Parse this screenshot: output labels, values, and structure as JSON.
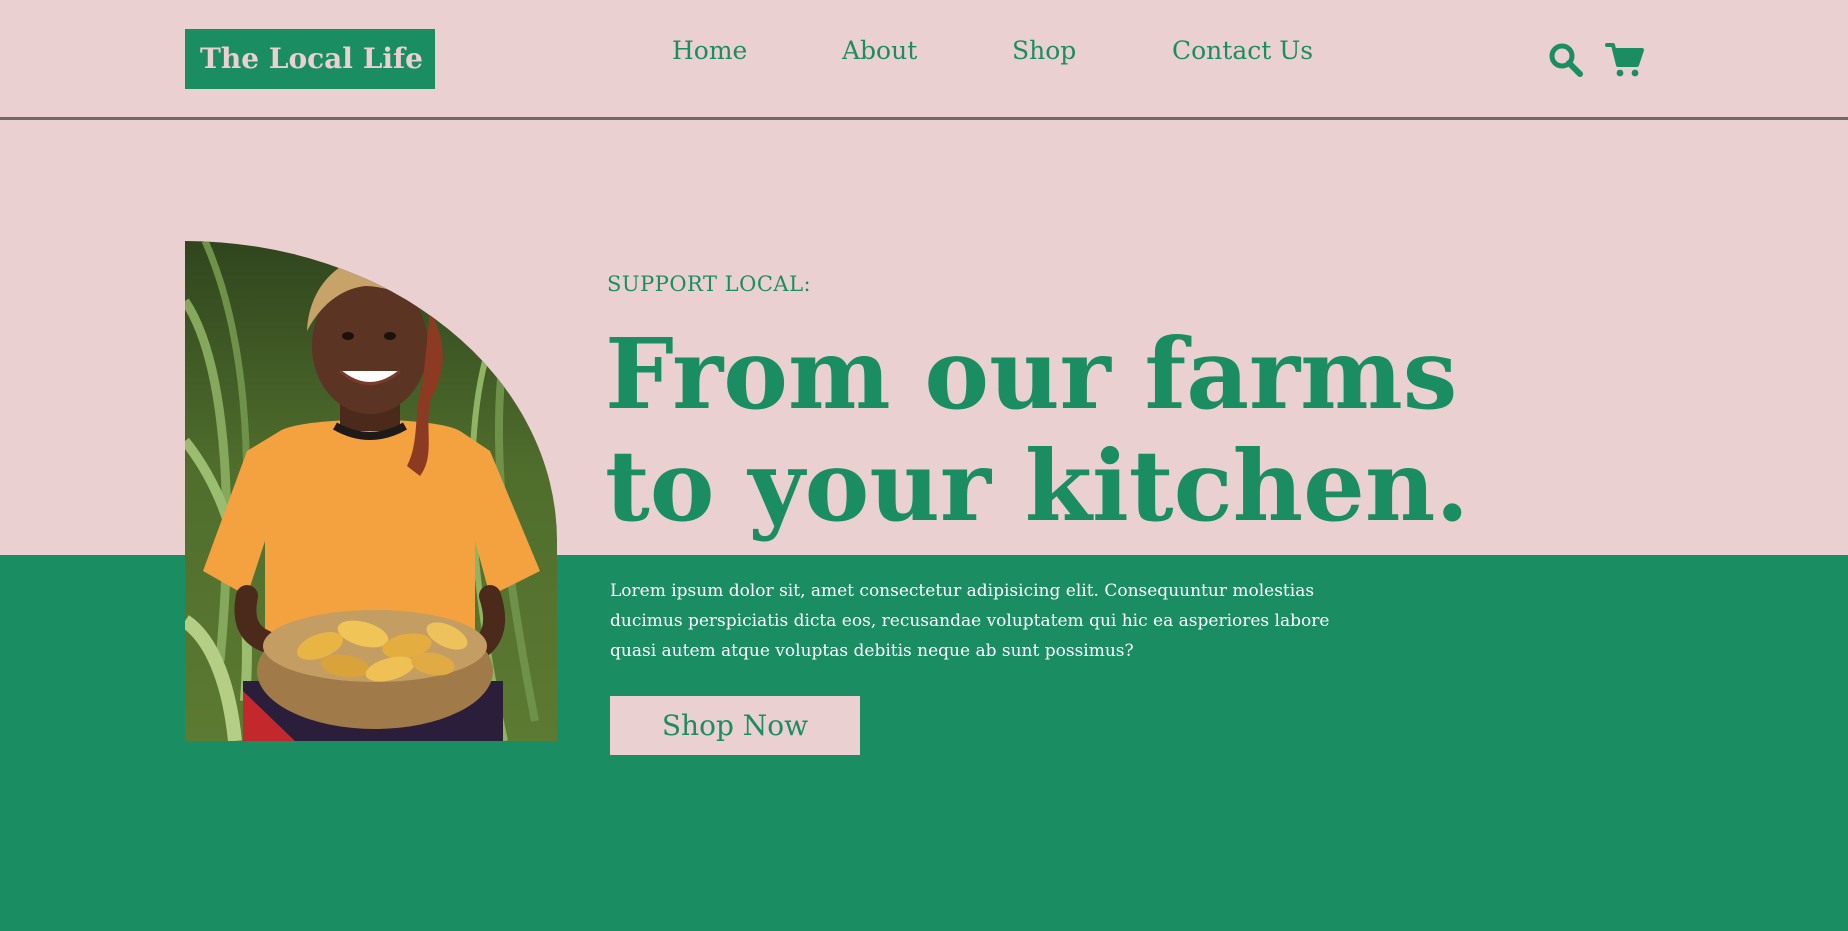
{
  "brand": {
    "name": "The Local Life"
  },
  "nav": {
    "items": [
      "Home",
      "About",
      "Shop",
      "Contact Us"
    ]
  },
  "header_icons": [
    "search-icon",
    "cart-icon"
  ],
  "hero": {
    "eyebrow": "SUPPORT LOCAL:",
    "headline_line1": "From our farms",
    "headline_line2": "to your kitchen.",
    "description": "Lorem ipsum dolor sit, amet consectetur adipisicing elit. Consequuntur molestias ducimus perspiciatis dicta eos, recusandae voluptatem qui hic ea asperiores labore quasi autem atque voluptas debitis neque ab sunt possimus?",
    "cta_label": "Shop Now",
    "image": "farmer-with-corn-basket"
  },
  "colors": {
    "accent_green": "#1b8d62",
    "blush_pink": "#ebd0d1",
    "divider_gray": "#6e6a6a",
    "text_white": "#ffffff"
  }
}
